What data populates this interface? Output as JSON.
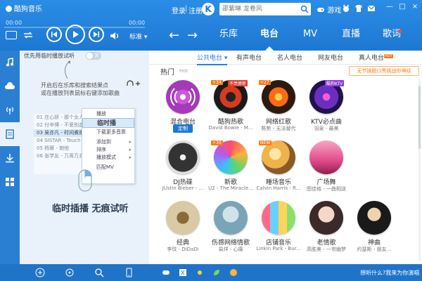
{
  "window": {
    "app_title": "酷狗音乐",
    "minimize": "—",
    "maximize": "□",
    "close": "×"
  },
  "header": {
    "login": "登录",
    "separator": "|",
    "register": "注册",
    "k_logo": "K",
    "search": {
      "placeholder": "邵紫琳 龙卷风"
    },
    "tools": {
      "game": "游戏"
    }
  },
  "player": {
    "time_start": "00:00",
    "time_end": "00:00",
    "progress": 0,
    "quality": "标准"
  },
  "nav": {
    "tabs": [
      {
        "label": "乐库"
      },
      {
        "label": "电台"
      },
      {
        "label": "MV"
      },
      {
        "label": "直播"
      },
      {
        "label": "歌词"
      }
    ],
    "active_tab": "电台"
  },
  "left_panel": {
    "first_listen_label": "优先用临时播放试听",
    "toggle_text": "关",
    "tip_line1": "开启后在乐库和搜索结果点",
    "tip_line2": "或在播放列表鼠标右键添加歌曲",
    "mini_list": [
      "01 庄心妍 - 那个女人",
      "02 付辛博 - 不爱别走",
      "03 吴亦凡 - 时间煮雨",
      "04 SISTAR - Touch My Bo",
      "05 杨幂 - 她他",
      "06 张学友 - 万男万女"
    ],
    "context_menu": [
      "播放",
      "临时播",
      "下载更多音质",
      "添加到",
      "排序",
      "播放模式",
      "匹配MV"
    ],
    "slogan": "临时插播  无痕试听"
  },
  "main": {
    "sub_tabs": [
      {
        "label": "公共电台",
        "active": true
      },
      {
        "label": "有声电台"
      },
      {
        "label": "名人电台"
      },
      {
        "label": "网友电台"
      },
      {
        "label": "真人电台",
        "badge": "hot"
      }
    ],
    "section_title": "热门",
    "section_sub": "Hot",
    "promo": "无节操脱口秀挑战你神经",
    "cards": [
      {
        "title": "混合电台",
        "desc": "",
        "badge": "定制"
      },
      {
        "title": "酷狗热歌",
        "desc": "David Bowie - M...",
        "num_tag": "+34",
        "label_tag": "不羡撩新"
      },
      {
        "title": "网络红歌",
        "desc": "陈势 - 无法替代",
        "num_tag": "+27"
      },
      {
        "title": "KTV必点曲",
        "desc": "羽泉 - 最美",
        "label_tag": "酷狗KTV"
      },
      {
        "title": "DJ热碟",
        "desc": "JUstin Bieber - ..."
      },
      {
        "title": "新歌",
        "desc": "U2 - The Miracle...",
        "num_tag": "+30"
      },
      {
        "title": "睡场音乐",
        "desc": "Calvin Harris - R...",
        "num_tag": "NEW"
      },
      {
        "title": "广场舞",
        "desc": "图佳格 - 一曲相送"
      },
      {
        "title": "经典",
        "desc": "李玟 - DiDaDi"
      },
      {
        "title": "伤感网络情歌",
        "desc": "易烊 - 心痛"
      },
      {
        "title": "店铺音乐",
        "desc": "Linkin Park - Bur..."
      },
      {
        "title": "老情歌",
        "desc": "高胜美 - 一帘幽梦"
      },
      {
        "title": "神曲",
        "desc": "约瑟斯 - 朋友..."
      }
    ]
  },
  "bottom": {
    "recommend_text": "想听什么?我来为你演唱"
  },
  "colors": {
    "header_blue": "#1e78d2",
    "accent": "#2a7fd2",
    "hot_orange": "#ff7a1a",
    "hot_red": "#e23a2a"
  }
}
